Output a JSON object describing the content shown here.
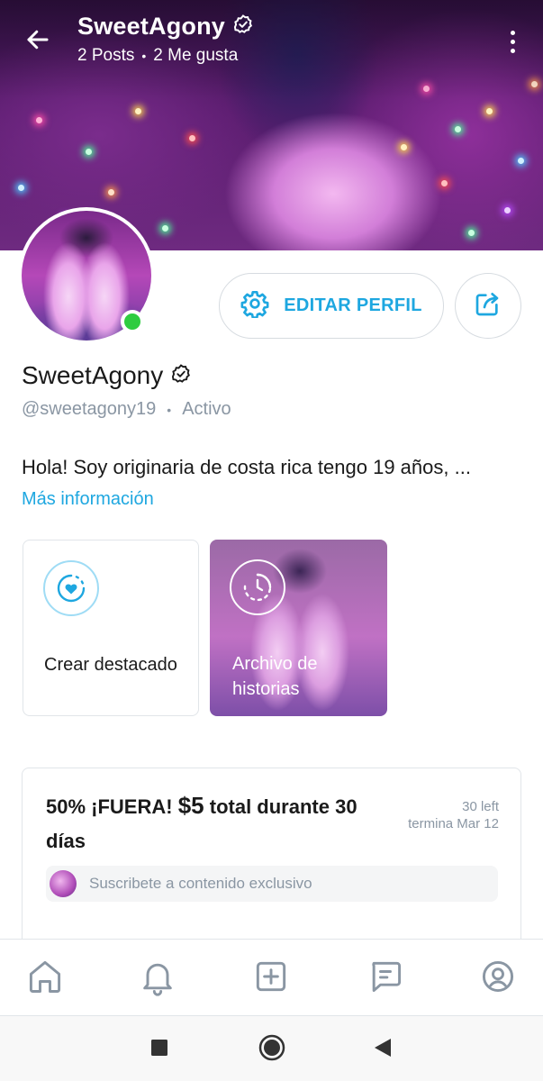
{
  "header": {
    "name": "SweetAgony",
    "posts": "2 Posts",
    "likes": "2 Me gusta",
    "separator": "•"
  },
  "profile": {
    "name": "SweetAgony",
    "handle": "@sweetagony19",
    "separator": "•",
    "status": "Activo",
    "bio": "Hola! Soy originaria de costa rica tengo 19 años, ...",
    "more_info": "Más información",
    "online": true
  },
  "actions": {
    "edit_label": "EDITAR PERFIL"
  },
  "highlights": [
    {
      "label": "Crear destacado"
    },
    {
      "label": "Archivo de historias"
    }
  ],
  "promo": {
    "title_prefix": "50% ¡FUERA!",
    "price": "$5",
    "title_suffix": "total durante 30 días",
    "left": "30 left",
    "ends": "termina Mar 12",
    "subscribe_text": "Suscribete a contenido exclusivo"
  },
  "bottom_nav": [
    {
      "icon": "home-icon"
    },
    {
      "icon": "bell-icon"
    },
    {
      "icon": "add-post-icon"
    },
    {
      "icon": "messages-icon"
    },
    {
      "icon": "profile-icon"
    }
  ],
  "system_nav": [
    {
      "icon": "recents-icon"
    },
    {
      "icon": "home-circle-icon"
    },
    {
      "icon": "back-triangle-icon"
    }
  ],
  "colors": {
    "accent": "#1ea7e0",
    "muted": "#8a96a3",
    "online": "#2ecc40",
    "border": "#e1e5e9"
  }
}
